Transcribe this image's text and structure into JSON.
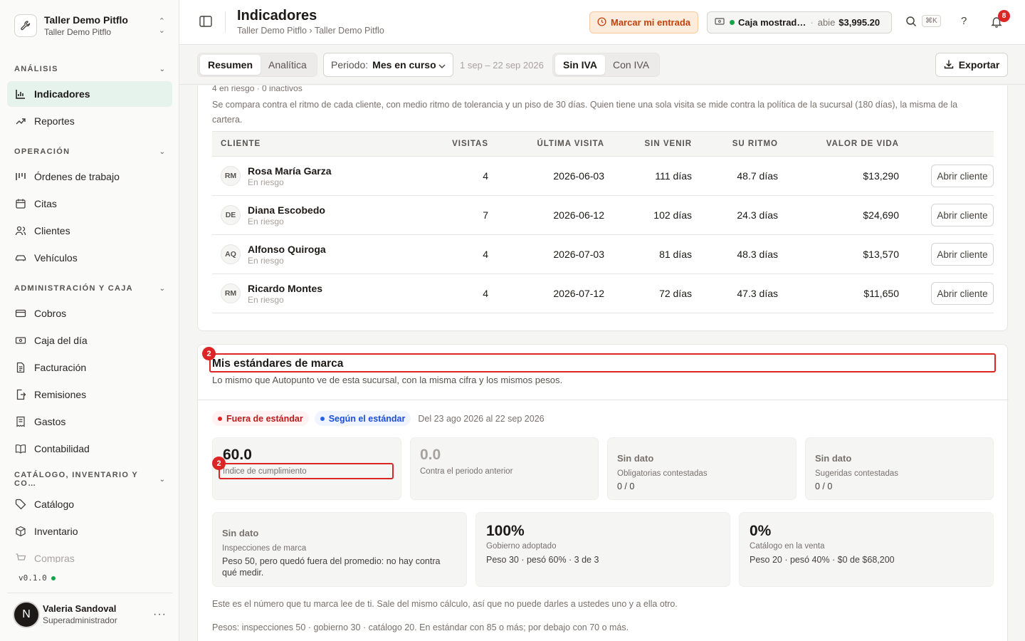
{
  "org": {
    "name": "Taller Demo Pitflo",
    "subtitle": "Taller Demo Pitflo"
  },
  "sidebar": {
    "sections": [
      {
        "title": "Análisis",
        "items": [
          "Indicadores",
          "Reportes"
        ]
      },
      {
        "title": "Operación",
        "items": [
          "Órdenes de trabajo",
          "Citas",
          "Clientes",
          "Vehículos"
        ]
      },
      {
        "title": "Administración y caja",
        "items": [
          "Cobros",
          "Caja del día",
          "Facturación",
          "Remisiones",
          "Gastos",
          "Contabilidad"
        ]
      },
      {
        "title": "Catálogo, inventario y co…",
        "items": [
          "Catálogo",
          "Inventario",
          "Compras"
        ]
      }
    ],
    "active_item": "Indicadores",
    "version": "v0.1.0",
    "user": {
      "initial": "N",
      "name": "Valeria Sandoval",
      "role": "Superadministrador"
    }
  },
  "header": {
    "title": "Indicadores",
    "breadcrumb": "Taller Demo Pitflo › Taller Demo Pitflo",
    "entrada_button": "Marcar mi entrada",
    "caja": {
      "name": "Caja mostrad…",
      "sep": "·",
      "status": "abie",
      "amount": "$3,995.20"
    },
    "search_shortcut": "⌘K",
    "help": "?",
    "notifications_count": "8"
  },
  "toolbar": {
    "tabs": [
      "Resumen",
      "Analítica"
    ],
    "active_tab": "Resumen",
    "period_label": "Periodo:",
    "period_value": "Mes en curso",
    "range": "1 sep – 22 sep 2026",
    "iva_options": [
      "Sin IVA",
      "Con IVA"
    ],
    "active_iva": "Sin IVA",
    "export_label": "Exportar"
  },
  "risk": {
    "stats": "4 en riesgo · 0 inactivos",
    "description": "Se compara contra el ritmo de cada cliente, con medio ritmo de tolerancia y un piso de 30 días. Quien tiene una sola visita se mide contra la política de la sucursal (180 días), la misma de la cartera.",
    "columns": [
      "Cliente",
      "Visitas",
      "Última visita",
      "Sin venir",
      "Su ritmo",
      "Valor de vida",
      ""
    ],
    "action_label": "Abrir cliente",
    "rows": [
      {
        "initials": "RM",
        "name": "Rosa María Garza",
        "status": "En riesgo",
        "visits": "4",
        "last": "2026-06-03",
        "absent": "111 días",
        "rhythm": "48.7 días",
        "ltv": "$13,290"
      },
      {
        "initials": "DE",
        "name": "Diana Escobedo",
        "status": "En riesgo",
        "visits": "7",
        "last": "2026-06-12",
        "absent": "102 días",
        "rhythm": "24.3 días",
        "ltv": "$24,690"
      },
      {
        "initials": "AQ",
        "name": "Alfonso Quiroga",
        "status": "En riesgo",
        "visits": "4",
        "last": "2026-07-03",
        "absent": "81 días",
        "rhythm": "48.3 días",
        "ltv": "$13,570"
      },
      {
        "initials": "RM",
        "name": "Ricardo Montes",
        "status": "En riesgo",
        "visits": "4",
        "last": "2026-07-12",
        "absent": "72 días",
        "rhythm": "47.3 días",
        "ltv": "$11,650"
      }
    ]
  },
  "brand": {
    "title": "Mis estándares de marca",
    "subtitle": "Lo mismo que Autopunto ve de esta sucursal, con la misma cifra y los mismos pesos.",
    "legend": {
      "out": "Fuera de estándar",
      "in": "Según el estándar",
      "dates": "Del 23 ago 2026 al 22 sep 2026",
      "out_color": "#dc2626",
      "in_color": "#2563eb"
    },
    "tiles_top": [
      {
        "value": "60.0",
        "label": "Índice de cumplimiento"
      },
      {
        "value": "0.0",
        "label": "Contra el periodo anterior"
      },
      {
        "value": "Sin dato",
        "label": "Obligatorias contestadas",
        "sub": "0 / 0"
      },
      {
        "value": "Sin dato",
        "label": "Sugeridas contestadas",
        "sub": "0 / 0"
      }
    ],
    "tiles_bottom": [
      {
        "value": "Sin dato",
        "label": "Inspecciones de marca",
        "sub": "Peso 50, pero quedó fuera del promedio: no hay contra qué medir."
      },
      {
        "value": "100%",
        "label": "Gobierno adoptado",
        "sub": "Peso 30 · pesó 60% · 3 de 3"
      },
      {
        "value": "0%",
        "label": "Catálogo en la venta",
        "sub": "Peso 20 · pesó 40% · $0 de $68,200"
      }
    ],
    "footnote": "Este es el número que tu marca lee de ti. Sale del mismo cálculo, así que no puede darles a ustedes uno y a ella otro.",
    "weights": "Pesos: inspecciones 50 · gobierno 30 · catálogo 20. En estándar con 85 o más; por debajo con 70 o más."
  },
  "annotations": [
    "2",
    "2"
  ],
  "colors": {
    "accent": "#15803d",
    "annotation": "#dc2626",
    "entrada_bg": "#fdecdb",
    "entrada_text": "#c2410c"
  }
}
